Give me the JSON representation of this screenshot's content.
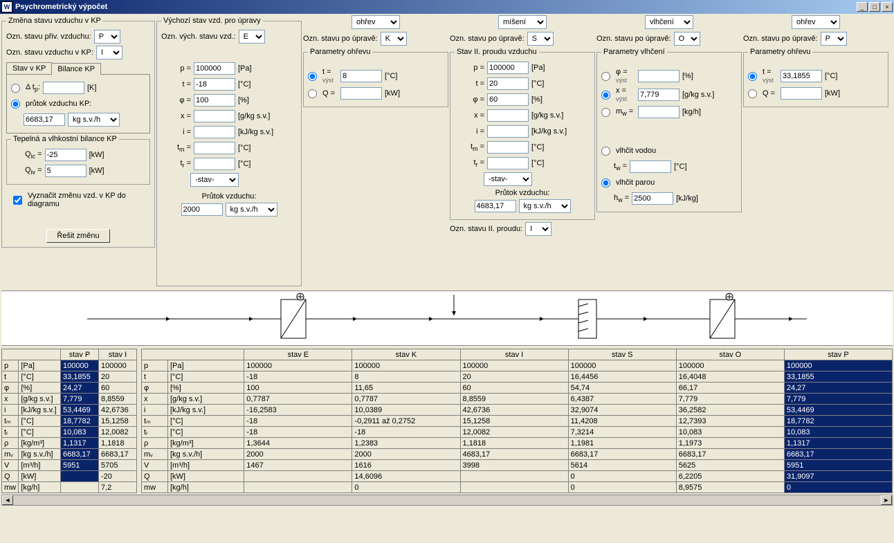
{
  "window": {
    "title": "Psychrometrický výpočet"
  },
  "col1": {
    "legend": "Změna stavu vzduchu v KP",
    "ozn_priv_label": "Ozn. stavu přiv. vzduchu:",
    "ozn_priv_val": "P",
    "ozn_kp_label": "Ozn. stavu vzduchu v KP:",
    "ozn_kp_val": "I",
    "tabs": {
      "stav": "Stav v KP",
      "bilance": "Bilance KP"
    },
    "dt_label": "Δ t",
    "dt_sub": "p",
    "dt_unit": "[K]",
    "prutok_label": "průtok vzduchu KP:",
    "prutok_val": "6683,17",
    "prutok_unit": "kg s.v./h",
    "bilance_legend": "Tepelná a vlhkostní bilance KP",
    "qic_label": "Q",
    "qic_sub": "ic",
    "qic_eq": "=",
    "qic_val": "-25",
    "qic_unit": "[kW]",
    "qiv_label": "Q",
    "qiv_sub": "iv",
    "qiv_eq": "=",
    "qiv_val": "5",
    "qiv_unit": "[kW]",
    "vyznacit": "Vyznačit změnu vzd. v KP do diagramu",
    "resit": "Řešit změnu"
  },
  "col2": {
    "legend": "Výchozí stav vzd. pro úpravy",
    "ozn_label": "Ozn. vých. stavu vzd.:",
    "ozn_val": "E",
    "p_label": "p =",
    "p_val": "100000",
    "p_unit": "[Pa]",
    "t_label": "t =",
    "t_val": "-18",
    "t_unit": "[°C]",
    "phi_label": "φ =",
    "phi_val": "100",
    "phi_unit": "[%]",
    "x_label": "x =",
    "x_val": "",
    "x_unit": "[g/kg s.v.]",
    "i_label": "i =",
    "i_val": "",
    "i_unit": "[kJ/kg s.v.]",
    "tm_label": "t",
    "tm_sub": "m",
    "tm_eq": "=",
    "tm_val": "",
    "tm_unit": "[°C]",
    "tr_label": "t",
    "tr_sub": "r",
    "tr_eq": "=",
    "tr_val": "",
    "tr_unit": "[°C]",
    "stav_sel": "-stav-",
    "prutok_label": "Průtok vzduchu:",
    "prutok_val": "2000",
    "prutok_unit": "kg s.v./h"
  },
  "col3": {
    "op": "ohřev",
    "ozn_label": "Ozn. stavu po úpravě:",
    "ozn_val": "K",
    "params_legend": "Parametry ohřevu",
    "t_label": "t =",
    "t_vyst": "výst",
    "t_val": "8",
    "t_unit": "[°C]",
    "q_label": "Q =",
    "q_val": "",
    "q_unit": "[kW]"
  },
  "col4": {
    "op": "míšení",
    "ozn_label": "Ozn. stavu po úpravě:",
    "ozn_val": "S",
    "params_legend": "Stav II. proudu vzduchu",
    "p_label": "p =",
    "p_val": "100000",
    "p_unit": "[Pa]",
    "t_label": "t =",
    "t_val": "20",
    "t_unit": "[°C]",
    "phi_label": "φ =",
    "phi_val": "60",
    "phi_unit": "[%]",
    "x_label": "x =",
    "x_unit": "[g/kg s.v.]",
    "i_label": "i =",
    "i_unit": "[kJ/kg s.v.]",
    "tm_label": "t",
    "tm_sub": "m",
    "tm_eq": "=",
    "tm_unit": "[°C]",
    "tr_label": "t",
    "tr_sub": "r",
    "tr_eq": "=",
    "tr_unit": "[°C]",
    "stav_sel": "-stav-",
    "prutok_label": "Průtok vzduchu:",
    "prutok_val": "4683,17",
    "prutok_unit": "kg s.v./h",
    "ozn2_label": "Ozn. stavu II. proudu:",
    "ozn2_val": "I"
  },
  "col5": {
    "op": "vlhčení",
    "ozn_label": "Ozn. stavu po úpravě:",
    "ozn_val": "O",
    "params_legend": "Parametry vlhčení",
    "phi_label": "φ =",
    "phi_vyst": "výst",
    "phi_unit": "[%]",
    "x_label": "x =",
    "x_vyst": "výst",
    "x_val": "7,779",
    "x_unit": "[g/kg s.v.]",
    "mw_label": "m",
    "mw_sub": "w",
    "mw_eq": "=",
    "mw_unit": "[kg/h]",
    "vodou": "vlhčit vodou",
    "tw_label": "t",
    "tw_sub": "w",
    "tw_eq": "=",
    "tw_unit": "[°C]",
    "parou": "vlhčit parou",
    "hw_label": "h",
    "hw_sub": "w",
    "hw_eq": "=",
    "hw_val": "2500",
    "hw_unit": "[kJ/kg]"
  },
  "col6": {
    "op": "ohřev",
    "ozn_label": "Ozn. stavu po úpravě:",
    "ozn_val": "P",
    "params_legend": "Parametry ohřevu",
    "t_label": "t =",
    "t_vyst": "výst",
    "t_val": "33,1855",
    "t_unit": "[°C]",
    "q_label": "Q =",
    "q_unit": "[kW]"
  },
  "table1": {
    "headers": [
      "",
      "stav P",
      "stav I"
    ],
    "rows": [
      [
        "p",
        "[Pa]",
        "100000",
        "100000"
      ],
      [
        "t",
        "[°C]",
        "33,1855",
        "20"
      ],
      [
        "φ",
        "[%]",
        "24,27",
        "60"
      ],
      [
        "x",
        "[g/kg s.v.]",
        "7,779",
        "8,8559"
      ],
      [
        "i",
        "[kJ/kg s.v.]",
        "53,4469",
        "42,6736"
      ],
      [
        "tₘ",
        "[°C]",
        "18,7782",
        "15,1258"
      ],
      [
        "tᵣ",
        "[°C]",
        "10,083",
        "12,0082"
      ],
      [
        "ρ",
        "[kg/m³]",
        "1,1317",
        "1,1818"
      ],
      [
        "mᵥ",
        "[kg s.v./h]",
        "6683,17",
        "6683,17"
      ],
      [
        "V",
        "[m³/h]",
        "5951",
        "5705"
      ],
      [
        "Q",
        "[kW]",
        "",
        "-20"
      ],
      [
        "mw",
        "[kg/h]",
        "",
        "7,2"
      ]
    ]
  },
  "table2": {
    "headers": [
      "",
      "stav E",
      "stav K",
      "stav I",
      "stav S",
      "stav O",
      "stav P"
    ],
    "rows": [
      [
        "p",
        "[Pa]",
        "100000",
        "100000",
        "100000",
        "100000",
        "100000",
        "100000"
      ],
      [
        "t",
        "[°C]",
        "-18",
        "8",
        "20",
        "16,4456",
        "16,4048",
        "33,1855"
      ],
      [
        "φ",
        "[%]",
        "100",
        "11,65",
        "60",
        "54,74",
        "66,17",
        "24,27"
      ],
      [
        "x",
        "[g/kg s.v.]",
        "0,7787",
        "0,7787",
        "8,8559",
        "6,4387",
        "7,779",
        "7,779"
      ],
      [
        "i",
        "[kJ/kg s.v.]",
        "-16,2583",
        "10,0389",
        "42,6736",
        "32,9074",
        "36,2582",
        "53,4469"
      ],
      [
        "tₘ",
        "[°C]",
        "-18",
        "-0,2911 až 0,2752",
        "15,1258",
        "11,4208",
        "12,7393",
        "18,7782"
      ],
      [
        "tᵣ",
        "[°C]",
        "-18",
        "-18",
        "12,0082",
        "7,3214",
        "10,083",
        "10,083"
      ],
      [
        "ρ",
        "[kg/m³]",
        "1,3644",
        "1,2383",
        "1,1818",
        "1,1981",
        "1,1973",
        "1,1317"
      ],
      [
        "mᵥ",
        "[kg s.v./h]",
        "2000",
        "2000",
        "4683,17",
        "6683,17",
        "6683,17",
        "6683,17"
      ],
      [
        "V",
        "[m³/h]",
        "1467",
        "1616",
        "3998",
        "5614",
        "5625",
        "5951"
      ],
      [
        "Q",
        "[kW]",
        "",
        "14,6096",
        "",
        "0",
        "6,2205",
        "31,9097"
      ],
      [
        "mw",
        "[kg/h]",
        "",
        "0",
        "",
        "0",
        "8,9575",
        "0"
      ]
    ]
  }
}
